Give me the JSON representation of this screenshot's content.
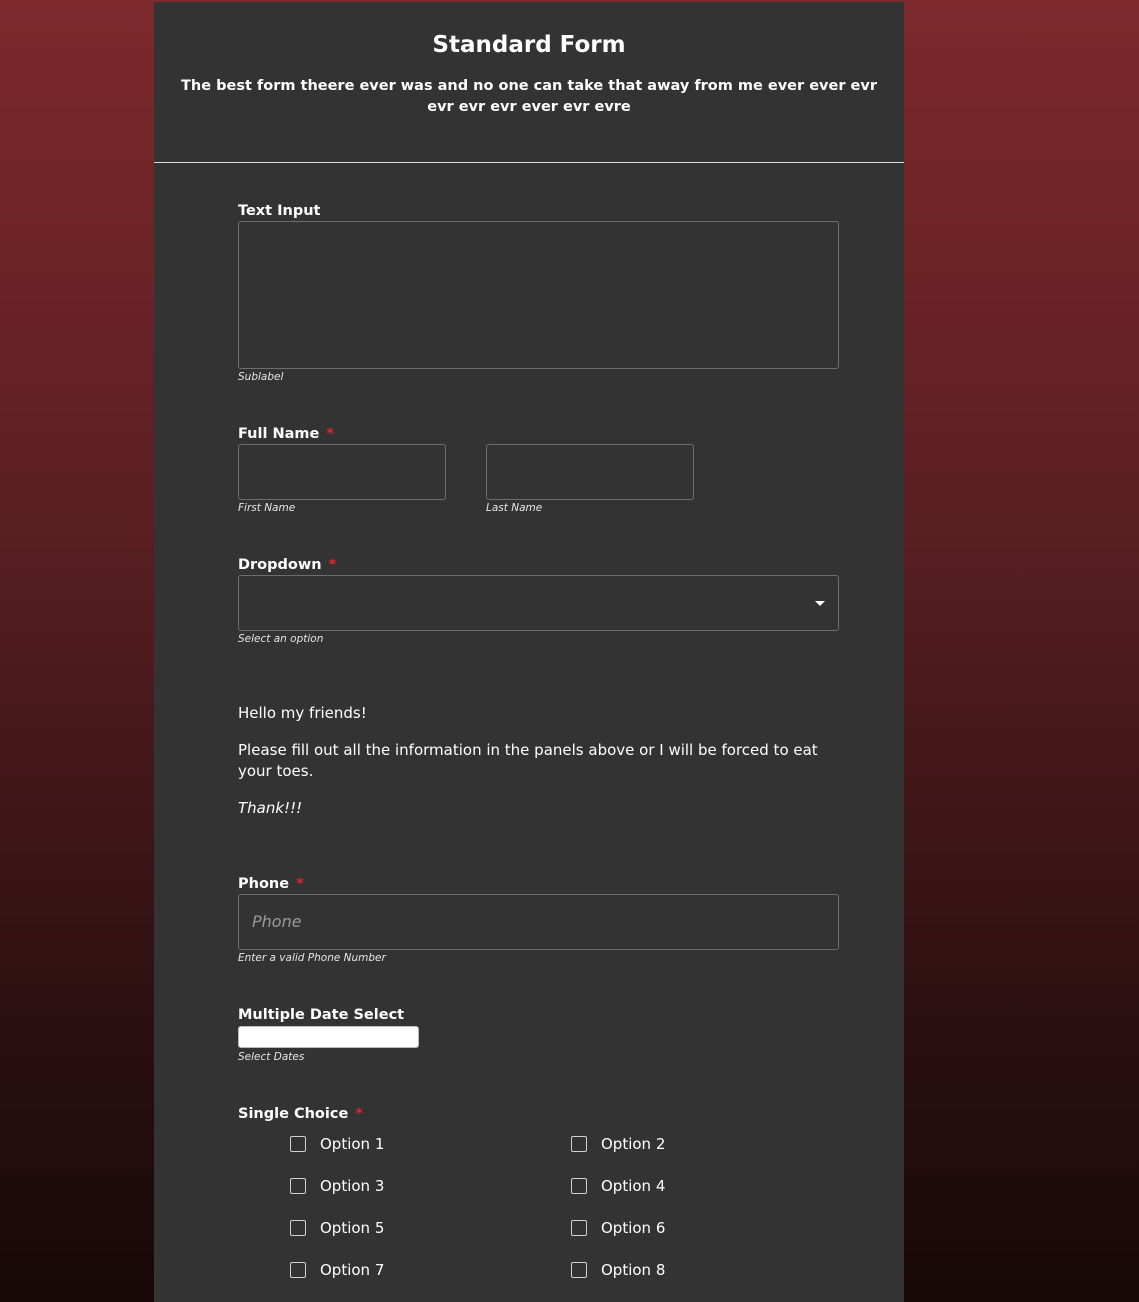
{
  "header": {
    "title": "Standard Form",
    "description": "The best form theere ever was and no one can take that away from me ever ever evr evr evr evr ever evr evre"
  },
  "text_input": {
    "label": "Text Input",
    "sublabel": "Sublabel",
    "value": ""
  },
  "full_name": {
    "label": "Full Name",
    "required_mark": "*",
    "first_sublabel": "First Name",
    "last_sublabel": "Last Name",
    "first_value": "",
    "last_value": ""
  },
  "dropdown": {
    "label": "Dropdown",
    "required_mark": "*",
    "sublabel": "Select an option",
    "selected_value": "",
    "icon": "caret-down-icon"
  },
  "message": {
    "line1": "Hello my friends!",
    "line2": "Please fill out all the information in the panels above or I will be forced to eat your toes.",
    "line3": "Thank!!!"
  },
  "phone": {
    "label": "Phone",
    "required_mark": "*",
    "placeholder": "Phone",
    "sublabel": "Enter a valid Phone Number"
  },
  "date_select": {
    "label": "Multiple Date Select",
    "sublabel": "Select Dates",
    "value": ""
  },
  "single_choice": {
    "label": "Single Choice",
    "required_mark": "*",
    "options": [
      "Option 1",
      "Option 2",
      "Option 3",
      "Option 4",
      "Option 5",
      "Option 6",
      "Option 7",
      "Option 8"
    ]
  },
  "colors": {
    "page_gradient_top": "#7e282c",
    "page_gradient_bottom": "#180808",
    "card_background": "#333333",
    "required_marker": "#e0262c"
  }
}
